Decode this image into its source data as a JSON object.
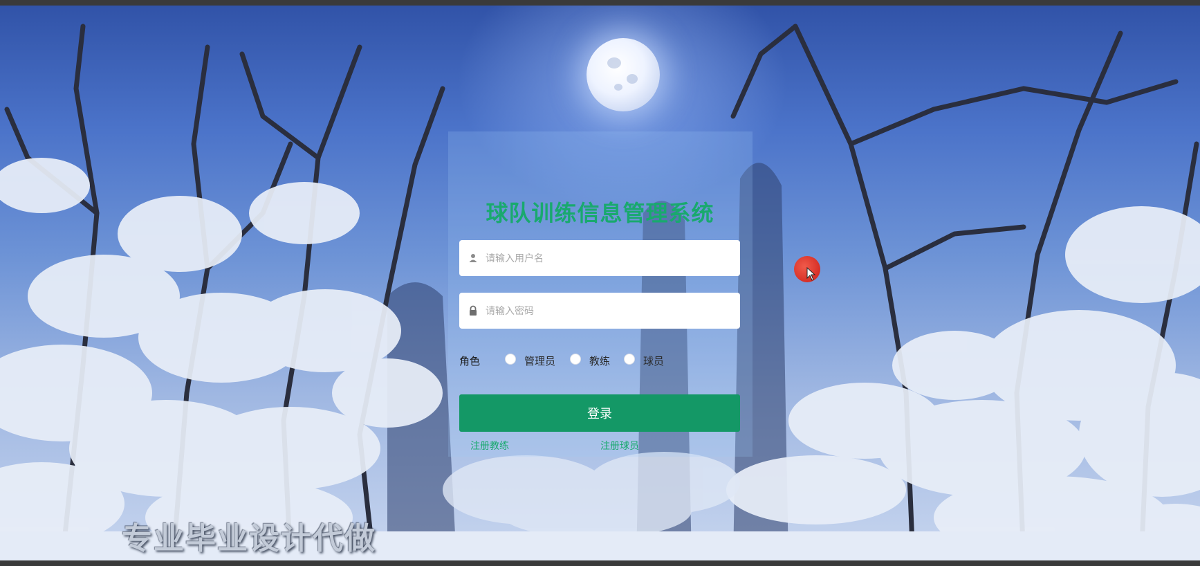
{
  "app": {
    "title": "球队训练信息管理系统"
  },
  "form": {
    "username": {
      "placeholder": "请输入用户名",
      "value": ""
    },
    "password": {
      "placeholder": "请输入密码",
      "value": ""
    },
    "role": {
      "label": "角色",
      "options": [
        "管理员",
        "教练",
        "球员"
      ],
      "selected": ""
    },
    "login_label": "登录",
    "links": [
      "注册教练",
      "注册球员"
    ]
  },
  "watermark": "专业毕业设计代做",
  "icons": {
    "user": "user-icon",
    "lock": "lock-icon",
    "cursor": "mouse-cursor-icon"
  },
  "colors": {
    "accent": "#149866",
    "title": "#19a96e",
    "sky_top": "#3153a8",
    "snow": "#e8eef8"
  }
}
